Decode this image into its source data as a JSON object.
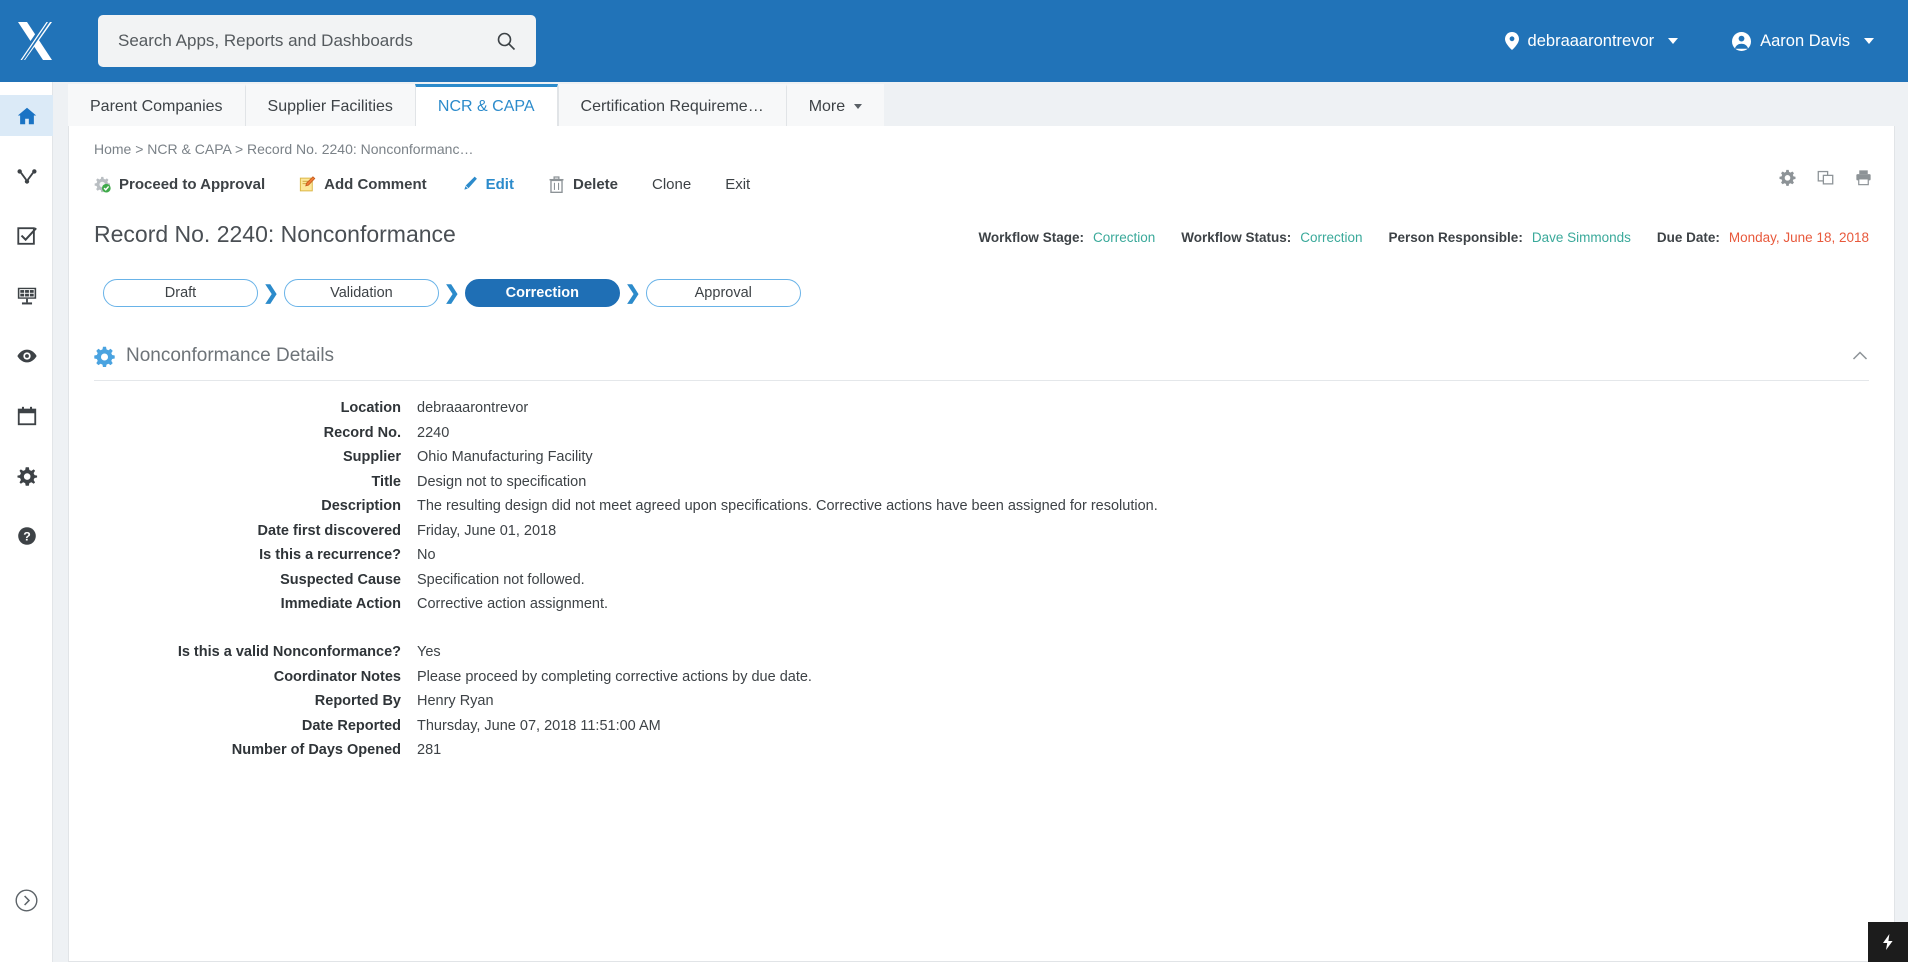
{
  "header": {
    "logo_icon": "x-logo-icon",
    "search": {
      "placeholder": "Search Apps, Reports and Dashboards",
      "value": "",
      "icon": "search-icon"
    },
    "location": {
      "label": "debraaarontrevor",
      "icon": "location-pin-icon"
    },
    "user": {
      "label": "Aaron Davis",
      "icon": "user-avatar-icon"
    }
  },
  "sidebar": {
    "items": [
      {
        "name": "home",
        "icon": "home-icon",
        "active": true
      },
      {
        "name": "workflow",
        "icon": "workflow-branch-icon",
        "active": false
      },
      {
        "name": "tasks",
        "icon": "checkbox-task-icon",
        "active": false
      },
      {
        "name": "dashboards",
        "icon": "dashboard-grid-icon",
        "active": false
      },
      {
        "name": "watch",
        "icon": "eye-icon",
        "active": false
      },
      {
        "name": "calendar",
        "icon": "calendar-icon",
        "active": false
      },
      {
        "name": "settings",
        "icon": "gear-icon",
        "active": false
      },
      {
        "name": "help",
        "icon": "help-circle-icon",
        "active": false
      }
    ],
    "expand": {
      "icon": "chevron-right-circle-icon"
    }
  },
  "tabs": [
    {
      "label": "Parent Companies",
      "active": false,
      "caret": false
    },
    {
      "label": "Supplier Facilities",
      "active": false,
      "caret": false
    },
    {
      "label": "NCR & CAPA",
      "active": true,
      "caret": false
    },
    {
      "label": "Certification Requireme…",
      "active": false,
      "caret": false
    },
    {
      "label": "More",
      "active": false,
      "caret": true
    }
  ],
  "breadcrumb": "Home > NCR & CAPA > Record No. 2240: Nonconformanc…",
  "actionbar": {
    "items": [
      {
        "label": "Proceed to Approval",
        "icon": "gear-check-icon",
        "style": "bold"
      },
      {
        "label": "Add Comment",
        "icon": "note-pencil-icon",
        "style": "bold"
      },
      {
        "label": "Edit",
        "icon": "pencil-icon",
        "style": "link"
      },
      {
        "label": "Delete",
        "icon": "trash-icon",
        "style": "bold"
      },
      {
        "label": "Clone",
        "icon": "",
        "style": "plain"
      },
      {
        "label": "Exit",
        "icon": "",
        "style": "plain"
      }
    ],
    "right_icons": [
      {
        "name": "gear-icon"
      },
      {
        "name": "duplicate-window-icon"
      },
      {
        "name": "print-icon"
      }
    ]
  },
  "record": {
    "title": "Record No. 2240: Nonconformance",
    "meta": [
      {
        "label": "Workflow Stage:",
        "value": "Correction",
        "style": "link"
      },
      {
        "label": "Workflow Status:",
        "value": "Correction",
        "style": "link"
      },
      {
        "label": "Person Responsible:",
        "value": "Dave Simmonds",
        "style": "link"
      },
      {
        "label": "Due Date:",
        "value": "Monday, June 18, 2018",
        "style": "due"
      }
    ]
  },
  "workflow": {
    "steps": [
      {
        "label": "Draft",
        "current": false
      },
      {
        "label": "Validation",
        "current": false
      },
      {
        "label": "Correction",
        "current": true
      },
      {
        "label": "Approval",
        "current": false
      }
    ],
    "separator": "❯"
  },
  "section": {
    "title": "Nonconformance Details",
    "icon": "gear-icon",
    "collapse_icon": "chevron-up-icon"
  },
  "fields": [
    {
      "label": "Location",
      "value": "debraaarontrevor",
      "gap": false
    },
    {
      "label": "Record No.",
      "value": "2240",
      "gap": false
    },
    {
      "label": "Supplier",
      "value": "Ohio Manufacturing Facility",
      "gap": false
    },
    {
      "label": "Title",
      "value": "Design not to specification",
      "gap": false
    },
    {
      "label": "Description",
      "value": "The resulting design did not meet agreed upon specifications. Corrective actions have been assigned for resolution.",
      "gap": false
    },
    {
      "label": "Date first discovered",
      "value": "Friday, June 01, 2018",
      "gap": false
    },
    {
      "label": "Is this a recurrence?",
      "value": "No",
      "gap": false
    },
    {
      "label": "Suspected Cause",
      "value": "Specification not followed.",
      "gap": false
    },
    {
      "label": "Immediate Action",
      "value": "Corrective action assignment.",
      "gap": false
    },
    {
      "label": "Is this a valid Nonconformance?",
      "value": "Yes",
      "gap": true
    },
    {
      "label": "Coordinator Notes",
      "value": "Please proceed by completing corrective actions by due date.",
      "gap": false
    },
    {
      "label": "Reported By",
      "value": "Henry Ryan",
      "gap": false
    },
    {
      "label": "Date Reported",
      "value": "Thursday, June 07, 2018 11:51:00 AM",
      "gap": false
    },
    {
      "label": "Number of Days Opened",
      "value": "281",
      "gap": false
    }
  ],
  "corner_badge": {
    "icon": "lightning-bolt-icon"
  },
  "colors": {
    "header_blue": "#2173b8",
    "accent_blue": "#2c8bcb",
    "step_active": "#1f6fb5",
    "link_teal": "#3aa99a",
    "due_red": "#e8593c",
    "page_bg": "#eef1f4"
  }
}
